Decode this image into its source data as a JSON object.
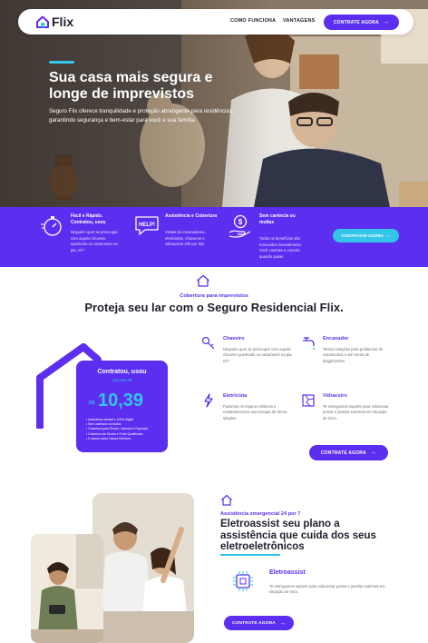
{
  "nav": {
    "brand": "Flix",
    "links": [
      "COMO FUNCIONA",
      "VANTAGENS"
    ],
    "cta": "CONTRATE AGORA",
    "cta_icon": "arrow-right-icon"
  },
  "hero": {
    "title": "Sua casa mais segura e longe de imprevistos",
    "text": "Seguro Flix oferece tranquilidade e proteção abrangente para residências, garantindo segurança e bem-estar para você e sua família."
  },
  "features": [
    {
      "icon": "stopwatch-icon",
      "title": "Fácil e Rápido. Contratou, usou",
      "text": "Ninguém quer se preocupar com aquele chuveiro queimado ou vazamento na pia, né?"
    },
    {
      "icon": "help-speech-icon",
      "title": "Assistência e Cobertura",
      "text": "Visitas de encanadores, eletricistas, chaveiros e vidraceiros 24h por dia!"
    },
    {
      "icon": "money-hand-icon",
      "title": "Sem carência ou multas",
      "text": "Todos os benefícios são renovados mensalmente. Você contrata e cancela quando quiser."
    }
  ],
  "band_cta": "CONTRATAR AGORA",
  "coverage": {
    "eyebrow": "Cobertura para imprevistos",
    "title": "Proteja seu lar com o Seguro Residencial Flix.",
    "card": {
      "title": "Contratou, usou",
      "subtitle": "Apenas de",
      "currency": "R$",
      "price": "10,39",
      "items": [
        "Assinatura mensal e 100% digital",
        "Sem carência ou multas",
        "Cobertura para Roubo, Incêndio e Explosão",
        "Cobertura de Roubo e Furto Qualificado",
        "6 meses sobre Danos Elétricos"
      ]
    },
    "services": [
      {
        "icon": "key-icon",
        "title": "Chaveiro",
        "text": "Ninguém quer se preocupar com aquele chuveiro queimado ou vazamento na pia, né?"
      },
      {
        "icon": "faucet-icon",
        "title": "Encanador",
        "text": "Temos soluções para problemas de vazamentos e até riscos de alagamentos."
      },
      {
        "icon": "lightning-icon",
        "title": "Eletricista",
        "text": "Fazemos os reparos elétricos e restabelecemos sua energia de forma simples."
      },
      {
        "icon": "broken-glass-icon",
        "title": "Vidraceiro",
        "text": "Te entregamos suporte para solucionar portas e janelas externas em situação de risco."
      }
    ],
    "cta": "CONTRATE AGORA"
  },
  "eletroassist": {
    "eyebrow": "Assistência emergencial 24 por 7",
    "title": "Eletroassist seu plano a assistência que cuida dos seus eletroeletrônicos",
    "name": "Eletroassist",
    "text": "Te entregamos suporte para solucionar portas e janelas externas em situação de risco.",
    "cta": "CONTRATE AGORA"
  },
  "colors": {
    "primary": "#5b2ef0",
    "accent": "#34c6e8"
  }
}
